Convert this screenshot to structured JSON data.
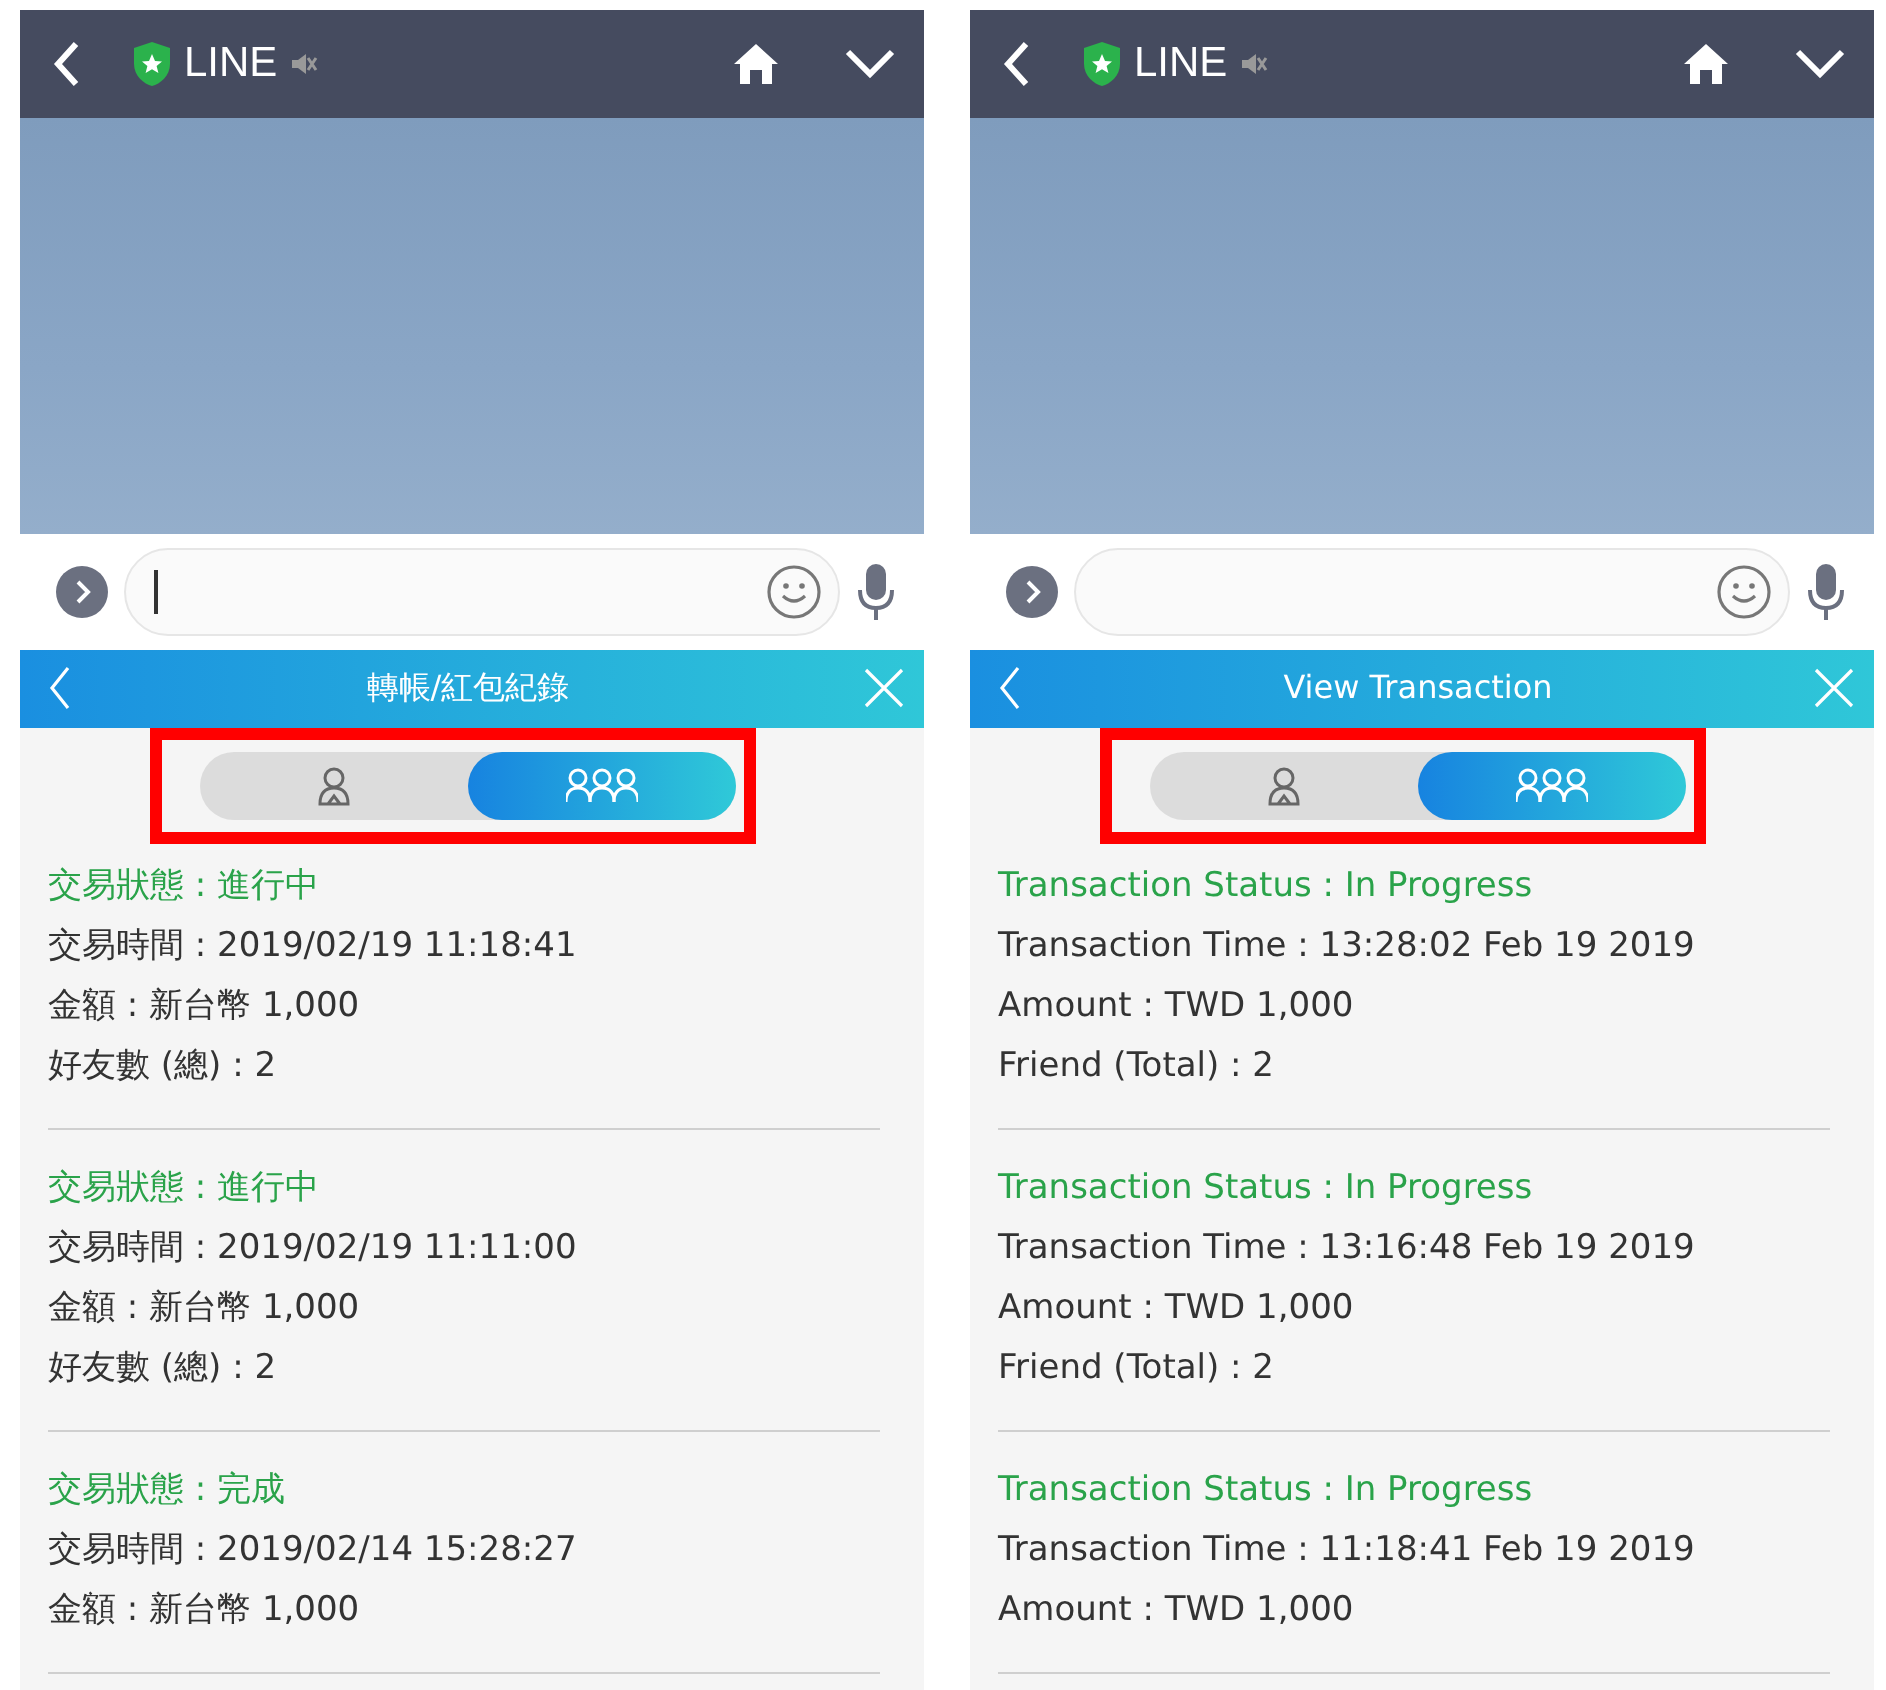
{
  "panels": [
    {
      "app_bar": {
        "title": "LINE"
      },
      "message_input": {
        "focused": true
      },
      "sheet": {
        "title": "轉帳/紅包紀錄",
        "tabs": [
          {
            "kind": "single",
            "selected": false
          },
          {
            "kind": "group",
            "selected": true
          }
        ],
        "highlighted": true
      },
      "transactions": [
        {
          "status": "交易狀態 : 進行中",
          "lines": [
            "交易時間 : 2019/02/19 11:18:41",
            "金額 : 新台幣 1,000",
            "好友數 (總) : 2"
          ]
        },
        {
          "status": "交易狀態 : 進行中",
          "lines": [
            "交易時間 : 2019/02/19 11:11:00",
            "金額 : 新台幣 1,000",
            "好友數 (總) : 2"
          ]
        },
        {
          "status": "交易狀態 : 完成",
          "lines": [
            "交易時間 : 2019/02/14 15:28:27",
            "金額 : 新台幣 1,000"
          ]
        }
      ]
    },
    {
      "app_bar": {
        "title": "LINE"
      },
      "message_input": {
        "focused": false
      },
      "sheet": {
        "title": "View Transaction",
        "tabs": [
          {
            "kind": "single",
            "selected": false
          },
          {
            "kind": "group",
            "selected": true
          }
        ],
        "highlighted": true
      },
      "transactions": [
        {
          "status": "Transaction Status : In Progress",
          "lines": [
            "Transaction Time : 13:28:02 Feb 19 2019",
            "Amount : TWD 1,000",
            "Friend (Total) : 2"
          ]
        },
        {
          "status": "Transaction Status : In Progress",
          "lines": [
            "Transaction Time : 13:16:48 Feb 19 2019",
            "Amount : TWD 1,000",
            "Friend (Total) : 2"
          ]
        },
        {
          "status": "Transaction Status : In Progress",
          "lines": [
            "Transaction Time : 11:18:41 Feb 19 2019",
            "Amount : TWD 1,000"
          ]
        }
      ]
    }
  ]
}
